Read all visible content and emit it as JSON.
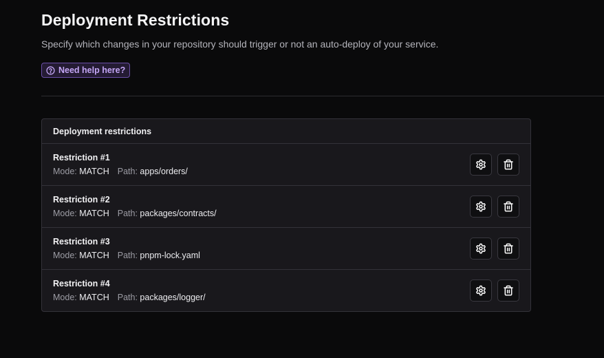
{
  "header": {
    "title": "Deployment Restrictions",
    "subtitle": "Specify which changes in your repository should trigger or not an auto-deploy of your service.",
    "help_label": "Need help here?"
  },
  "card": {
    "title": "Deployment restrictions",
    "mode_label": "Mode:",
    "path_label": "Path:",
    "restrictions": [
      {
        "title": "Restriction #1",
        "mode": "MATCH",
        "path": "apps/orders/"
      },
      {
        "title": "Restriction #2",
        "mode": "MATCH",
        "path": "packages/contracts/"
      },
      {
        "title": "Restriction #3",
        "mode": "MATCH",
        "path": "pnpm-lock.yaml"
      },
      {
        "title": "Restriction #4",
        "mode": "MATCH",
        "path": "packages/logger/"
      }
    ]
  },
  "icons": {
    "help": "question-circle-icon",
    "settings": "gear-icon",
    "delete": "trash-icon"
  },
  "colors": {
    "background": "#0a0a0b",
    "accent": "#c3a6f5",
    "card": "#19181c"
  }
}
